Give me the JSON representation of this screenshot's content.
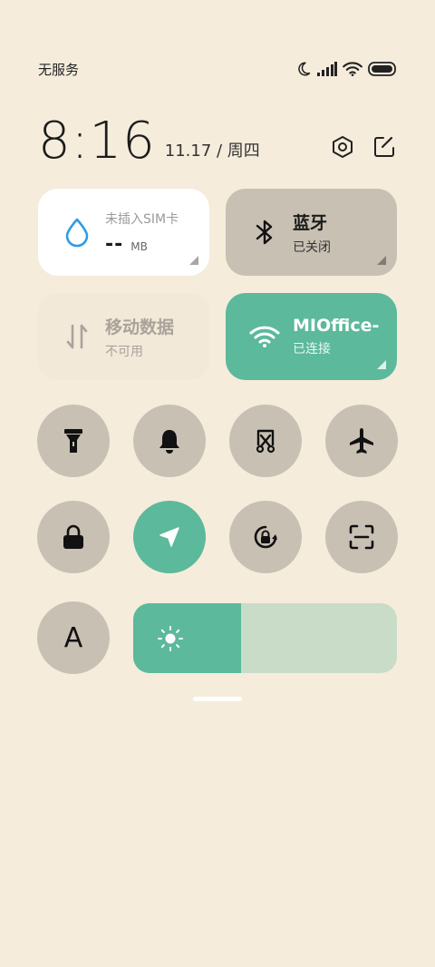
{
  "status_bar": {
    "carrier": "无服务"
  },
  "clock": {
    "time": "8:16",
    "date": "11.17 / 周四"
  },
  "tiles": {
    "sim": {
      "title": "未插入SIM卡",
      "usage": "--",
      "unit": "MB"
    },
    "bluetooth": {
      "title": "蓝牙",
      "status": "已关闭"
    },
    "mobile_data": {
      "title": "移动数据",
      "status": "不可用"
    },
    "wifi": {
      "title": "MIOffice-",
      "status": "已连接"
    }
  },
  "toggles": [
    {
      "name": "flashlight",
      "icon": "flashlight-icon",
      "active": false
    },
    {
      "name": "silent",
      "icon": "bell-icon",
      "active": false
    },
    {
      "name": "screenshot",
      "icon": "screenshot-icon",
      "active": false
    },
    {
      "name": "airplane",
      "icon": "airplane-icon",
      "active": false
    },
    {
      "name": "lock-screen",
      "icon": "lock-icon",
      "active": false
    },
    {
      "name": "location",
      "icon": "location-arrow-icon",
      "active": true
    },
    {
      "name": "rotation-lock",
      "icon": "rotation-lock-icon",
      "active": false
    },
    {
      "name": "scanner",
      "icon": "scan-icon",
      "active": false
    }
  ],
  "font_size_toggle": {
    "label": "A"
  },
  "brightness": {
    "level": 0.41
  },
  "colors": {
    "background": "#f5ecdc",
    "accent": "#5cb99b",
    "tile_inactive": "#c8c0b3",
    "brightness_track": "#c8dcc8",
    "water_icon": "#2e9be6"
  }
}
